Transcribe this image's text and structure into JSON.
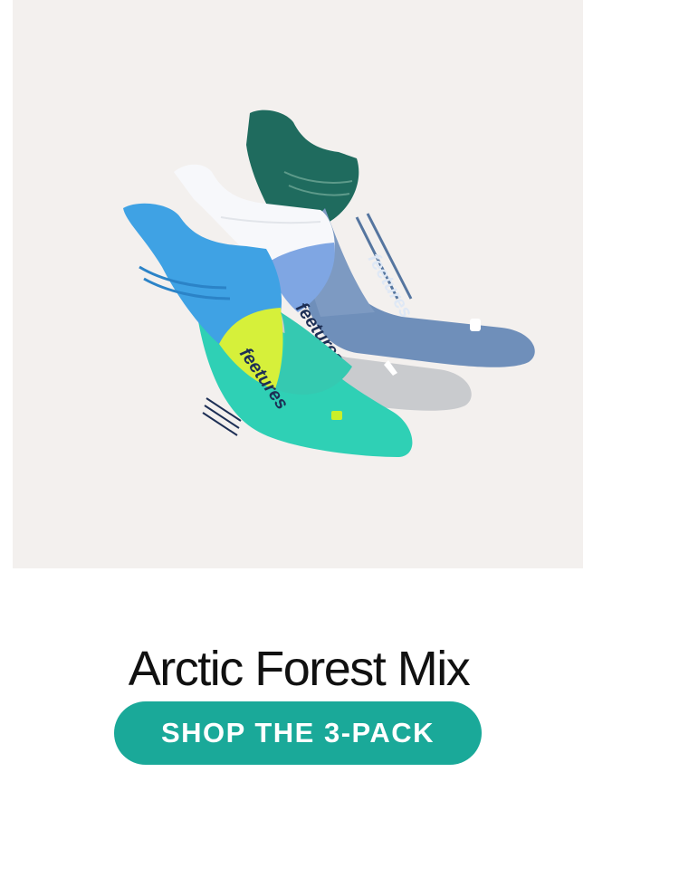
{
  "hero": {
    "brand_on_sock": "feetures"
  },
  "product": {
    "title": "Arctic Forest Mix"
  },
  "cta": {
    "label": "SHOP THE 3-PACK"
  },
  "colors": {
    "hero_background": "#f3f0ee",
    "cta_background": "#1aa999",
    "title_text": "#111111",
    "sock_back_green": "#1f6b5e",
    "sock_back_denim": "#6f8fba",
    "sock_middle_white": "#f7f8fb",
    "sock_middle_gray": "#c9cbce",
    "sock_front_blue": "#3fa2e4",
    "sock_front_lime": "#d6f03a",
    "sock_front_aqua": "#2fd0b5"
  }
}
